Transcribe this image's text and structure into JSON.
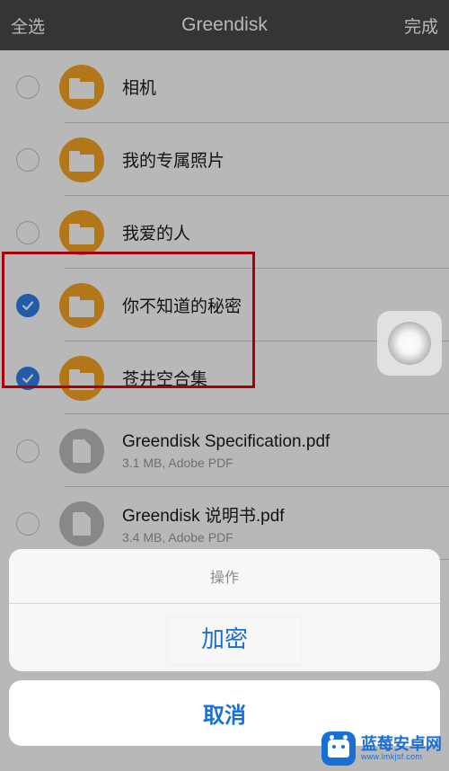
{
  "header": {
    "selectAll": "全选",
    "title": "Greendisk",
    "done": "完成"
  },
  "items": [
    {
      "name": "相机",
      "type": "folder",
      "meta": "",
      "selected": false
    },
    {
      "name": "我的专属照片",
      "type": "folder",
      "meta": "",
      "selected": false
    },
    {
      "name": "我爱的人",
      "type": "folder",
      "meta": "",
      "selected": false
    },
    {
      "name": "你不知道的秘密",
      "type": "folder",
      "meta": "",
      "selected": true
    },
    {
      "name": "苍井空合集",
      "type": "folder",
      "meta": "",
      "selected": true
    },
    {
      "name": "Greendisk Specification.pdf",
      "type": "pdf",
      "meta": "3.1 MB, Adobe PDF",
      "selected": false
    },
    {
      "name": "Greendisk 说明书.pdf",
      "type": "pdf",
      "meta": "3.4 MB, Adobe PDF",
      "selected": false
    }
  ],
  "actionSheet": {
    "title": "操作",
    "encrypt": "加密",
    "cancel": "取消"
  },
  "watermark": {
    "brand": "蓝莓安卓网",
    "url": "www.lmkjsf.com"
  }
}
